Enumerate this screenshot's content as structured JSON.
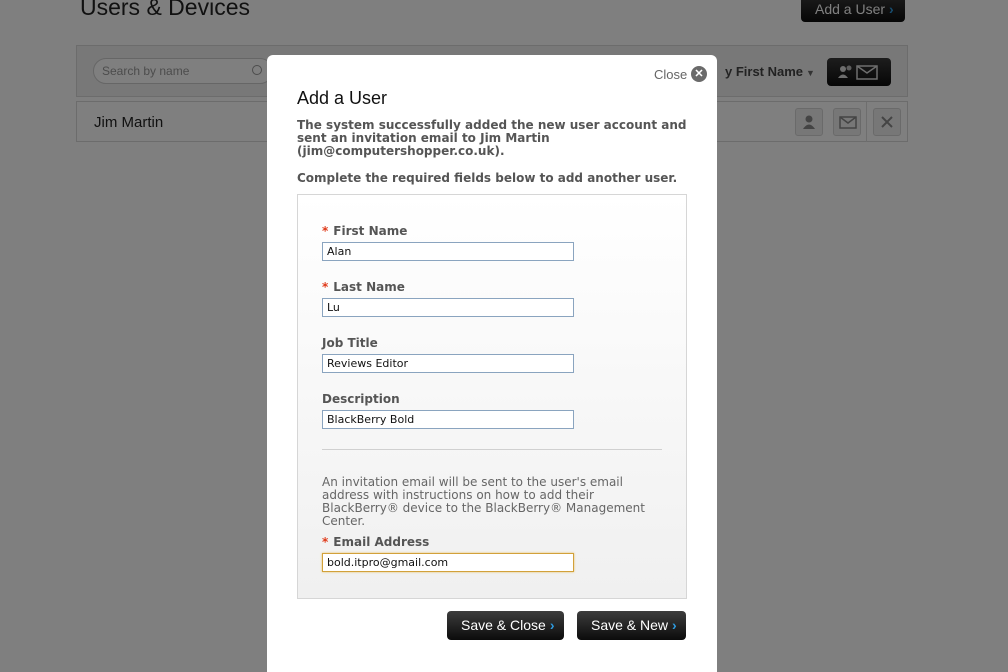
{
  "page": {
    "title": "Users & Devices",
    "add_user_label": "Add a User",
    "search_placeholder": "Search by name",
    "sort_label": "y First Name",
    "user_row_name": "Jim Martin"
  },
  "modal": {
    "close_label": "Close",
    "title": "Add a User",
    "success_message": "The system successfully added the new user account and sent an invitation email to Jim Martin (jim@computershopper.co.uk).",
    "instruction": "Complete the required fields below to add another user.",
    "fields": {
      "first_name": {
        "label": "First Name",
        "value": "Alan",
        "required": true
      },
      "last_name": {
        "label": "Last Name",
        "value": "Lu",
        "required": true
      },
      "job_title": {
        "label": "Job Title",
        "value": "Reviews Editor",
        "required": false
      },
      "description": {
        "label": "Description",
        "value": "BlackBerry Bold",
        "required": false
      },
      "email": {
        "label": "Email Address",
        "value": "bold.itpro@gmail.com",
        "required": true
      }
    },
    "info_text": "An invitation email will be sent to the user's email address with instructions on how to add their BlackBerry® device to the BlackBerry® Management Center.",
    "save_close_label": "Save & Close",
    "save_new_label": "Save & New"
  },
  "icons": {
    "chevron": "chevron-right-icon",
    "close": "close-icon",
    "search": "search-icon",
    "user": "user-icon",
    "mail": "mail-icon"
  },
  "colors": {
    "accent_chevron": "#2e9be0",
    "required_marker": "#e03a1a",
    "focus_border": "#d2a13a"
  }
}
